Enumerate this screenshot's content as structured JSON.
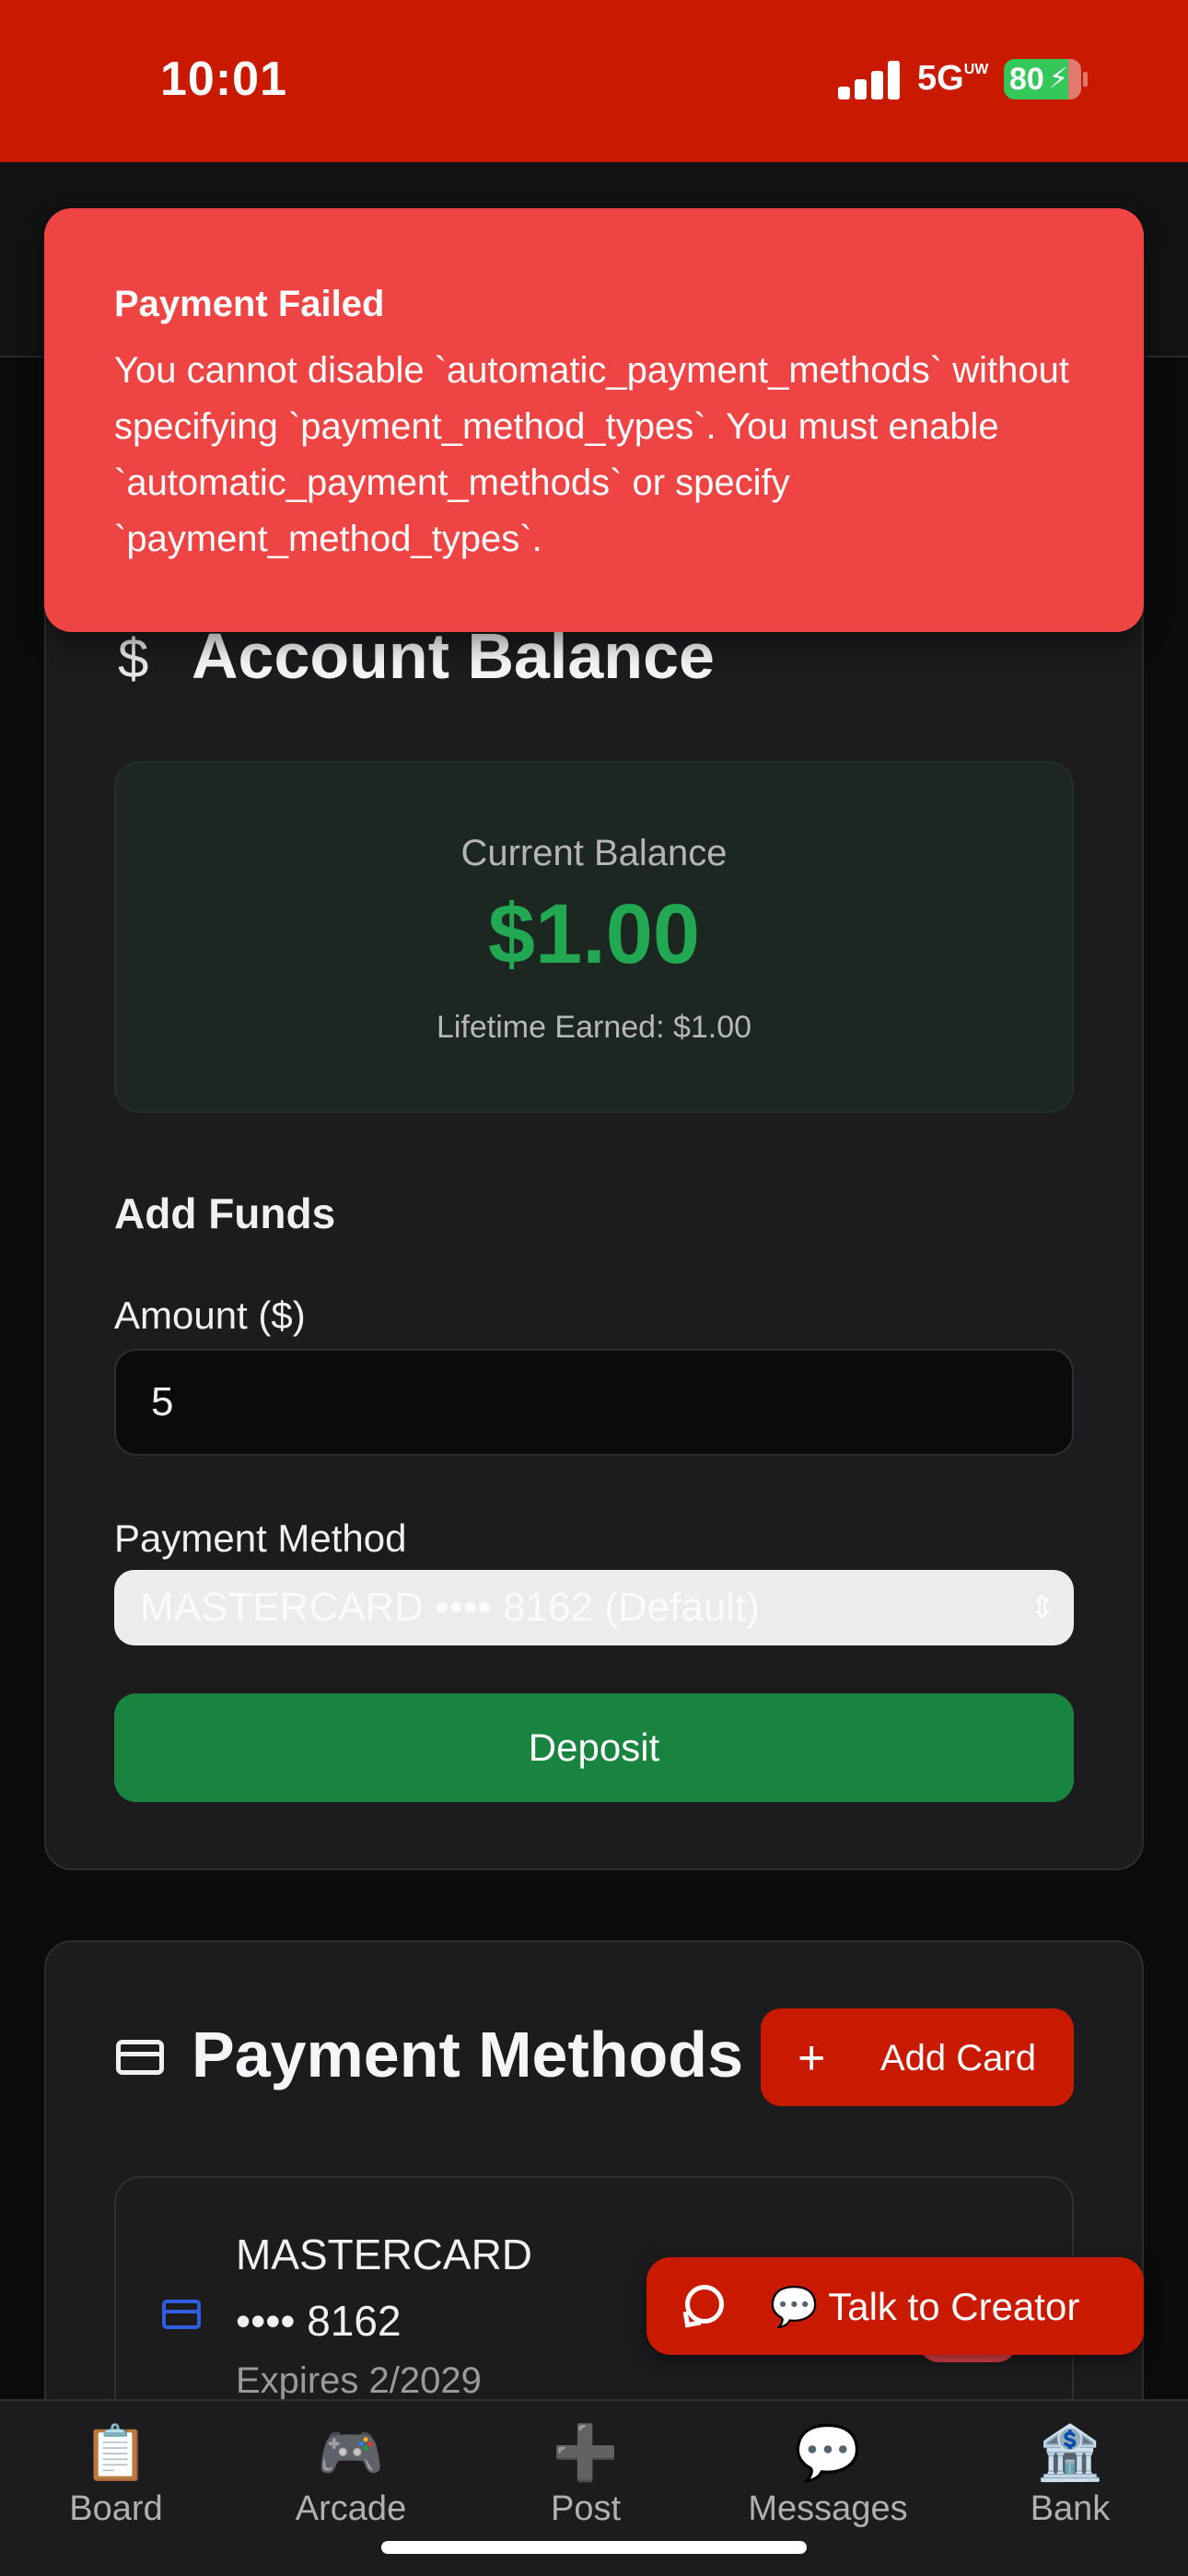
{
  "status_bar": {
    "time": "10:01",
    "network": "5G",
    "network_sup": "UW",
    "battery": "80"
  },
  "toast": {
    "title": "Payment Failed",
    "message": "You cannot disable `automatic_payment_methods` without specifying `payment_method_types`. You must enable `automatic_payment_methods` or specify `payment_method_types`."
  },
  "balance": {
    "title": "Account Balance",
    "icon": "$",
    "current_label": "Current Balance",
    "current_amount": "$1.00",
    "lifetime": "Lifetime Earned: $1.00"
  },
  "add_funds": {
    "title": "Add Funds",
    "amount_label": "Amount ($)",
    "amount_value": "5",
    "payment_method_label": "Payment Method",
    "payment_method_selected": "MASTERCARD •••• 8162 (Default)",
    "deposit_label": "Deposit"
  },
  "payment_methods": {
    "title": "Payment Methods",
    "add_card_label": "Add Card",
    "cards": [
      {
        "brand": "MASTERCARD",
        "digits": "•••• 8162",
        "expires": "Expires 2/2029"
      }
    ]
  },
  "talk_button": "💬 Talk to Creator",
  "nav": [
    {
      "icon": "📋",
      "label": "Board"
    },
    {
      "icon": "🎮",
      "label": "Arcade"
    },
    {
      "icon": "➕",
      "label": "Post"
    },
    {
      "icon": "💬",
      "label": "Messages"
    },
    {
      "icon": "🏦",
      "label": "Bank"
    }
  ],
  "colors": {
    "accent_red": "#c91a00",
    "toast_red": "#ef4444",
    "deposit_green": "#198440",
    "balance_green": "#22a852"
  }
}
